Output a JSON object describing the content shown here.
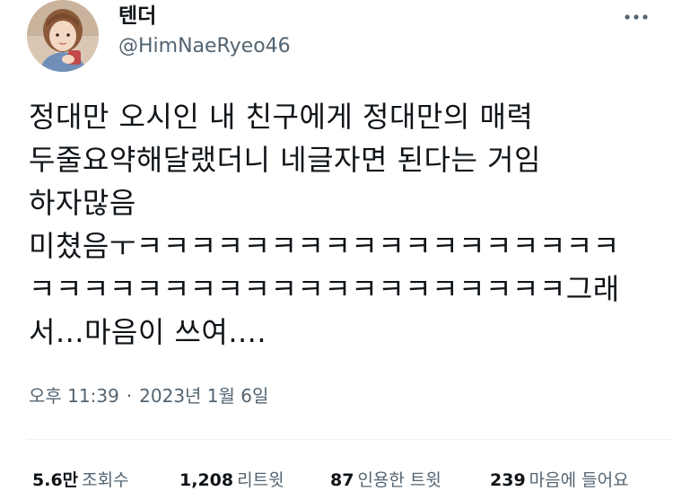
{
  "author": {
    "display_name": "텐더",
    "handle": "@HimNaeRyeo46",
    "avatar_icon": "profile-photo"
  },
  "more_icon": "more-dots-icon",
  "tweet": {
    "lines": [
      "정대만 오시인 내 친구에게 정대만의 매력",
      "두줄요약해달랬더니 네글자면 된다는 거임",
      "하자많음",
      "미쳤음ㅜㅋㅋㅋㅋㅋㅋㅋㅋㅋㅋㅋㅋㅋㅋㅋㅋㅋㅋ",
      "ㅋㅋㅋㅋㅋㅋㅋㅋㅋㅋㅋㅋㅋㅋㅋㅋㅋㅋㅋㅋ그래",
      "서...마음이 쓰여...."
    ]
  },
  "meta": {
    "time": "오후 11:39",
    "separator": "·",
    "date": "2023년 1월 6일"
  },
  "stats": {
    "views": {
      "count": "5.6만",
      "label": "조회수"
    },
    "retweets": {
      "count": "1,208",
      "label": "리트윗"
    },
    "quotes": {
      "count": "87",
      "label": "인용한 트윗"
    },
    "likes": {
      "count": "239",
      "label": "마음에 들어요"
    }
  },
  "colors": {
    "text_primary": "#0f1419",
    "text_secondary": "#536471",
    "divider": "#eff3f4"
  }
}
